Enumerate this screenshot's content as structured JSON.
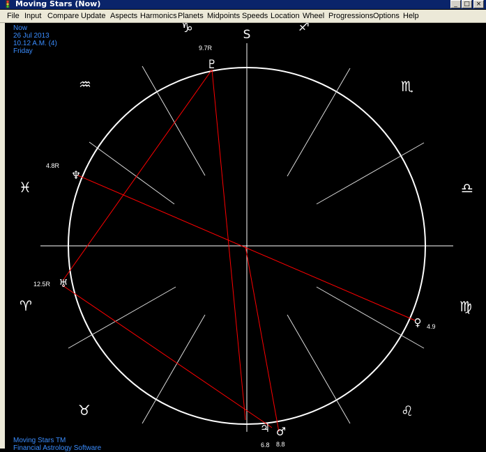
{
  "window": {
    "title": "Moving Stars (Now)",
    "buttons": [
      "_",
      "□",
      "×"
    ]
  },
  "menu": [
    "File",
    "Input",
    "Compare",
    "Update",
    "Aspects",
    "Harmonics",
    "Planets",
    "Midpoints",
    "Speeds",
    "Location",
    "Wheel",
    "Progressions",
    "Options",
    "Help"
  ],
  "info": {
    "label": "Now",
    "date": "26 Jul 2013",
    "time": "10.12 A.M. (4)",
    "weekday": "Friday"
  },
  "footer": {
    "line1": "Moving Stars TM",
    "line2": "Financial Astrology Software"
  },
  "wheel": {
    "south_label": "S",
    "signs": [
      "♑",
      "♐",
      "♏",
      "♎",
      "♍",
      "♌",
      "♉",
      "♈",
      "♓",
      "♒"
    ],
    "planets": [
      {
        "glyph": "♇",
        "value": "9.7R",
        "name": "pluto"
      },
      {
        "glyph": "♆",
        "value": "4.8R",
        "name": "neptune"
      },
      {
        "glyph": "♅",
        "value": "12.5R",
        "name": "uranus"
      },
      {
        "glyph": "♀",
        "value": "4.9",
        "name": "venus"
      },
      {
        "glyph": "♃",
        "value": "6.8",
        "name": "jupiter"
      },
      {
        "glyph": "♂",
        "value": "8.8",
        "name": "mars"
      }
    ],
    "colors": {
      "circle": "#ffffff",
      "aspect": "#ff0000",
      "info": "#3a8dff",
      "text": "#ffffff"
    }
  }
}
